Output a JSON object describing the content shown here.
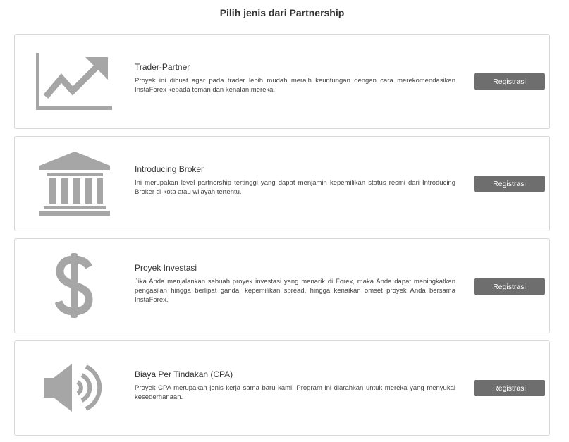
{
  "page": {
    "title": "Pilih jenis dari Partnership"
  },
  "cards": [
    {
      "icon": "chart-up-arrow-icon",
      "title": "Trader-Partner",
      "description": "Proyek ini dibuat agar pada trader lebih mudah meraih keuntungan dengan cara merekomendasikan InstaForex kepada teman dan kenalan mereka.",
      "button": "Registrasi"
    },
    {
      "icon": "bank-building-icon",
      "title": "Introducing Broker",
      "description": "Ini merupakan level partnership tertinggi yang dapat menjamin kepemilikan status resmi dari Introducing Broker di kota atau wilayah tertentu.",
      "button": "Registrasi"
    },
    {
      "icon": "dollar-sign-icon",
      "title": "Proyek Investasi",
      "description": "Jika Anda menjalankan sebuah proyek investasi yang menarik di Forex, maka Anda dapat meningkatkan pengasilan hingga berlipat ganda, kepemilikan spread, hingga kenaikan omset proyek Anda bersama InstaForex.",
      "button": "Registrasi"
    },
    {
      "icon": "speaker-volume-icon",
      "title": "Biaya Per Tindakan (CPA)",
      "description": "Proyek CPA merupakan jenis kerja sama baru kami. Program ini diarahkan untuk mereka yang menyukai kesederhanaan.",
      "button": "Registrasi"
    }
  ],
  "colors": {
    "icon": "#a6a6a6",
    "button": "#6e6e6e",
    "border": "#d8d8d8"
  }
}
